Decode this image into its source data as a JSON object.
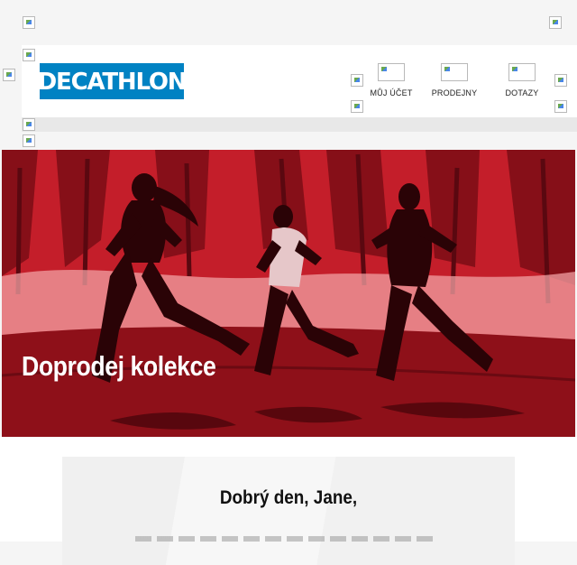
{
  "brand": {
    "logo_text": "DECATHLON",
    "color": "#0082c3"
  },
  "nav": {
    "items": [
      {
        "label": "MŮJ ÚČET",
        "icon": "account-icon"
      },
      {
        "label": "PRODEJNY",
        "icon": "store-icon"
      },
      {
        "label": "DOTAZY",
        "icon": "help-icon"
      }
    ]
  },
  "hero": {
    "title": "Doprodej kolekce",
    "overlay_color": "#c41e2a"
  },
  "content": {
    "greeting": "Dobrý den, Jane,"
  }
}
